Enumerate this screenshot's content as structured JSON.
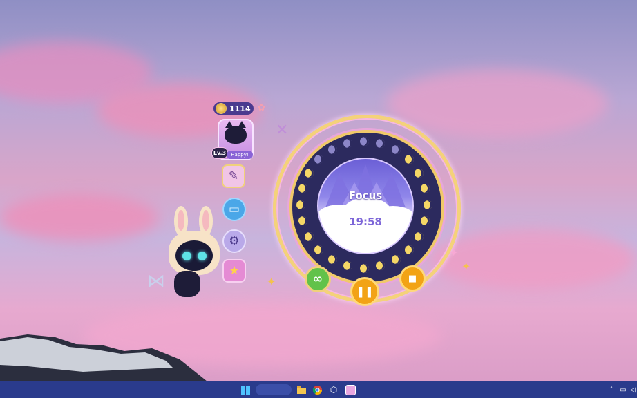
{
  "hud": {
    "coins": "1114",
    "level": "Lv.3",
    "mood": "Happy!"
  },
  "timer": {
    "mode": "Focus",
    "time": "19:58"
  },
  "icons": {
    "coin": "coin-icon",
    "flower": "flower-icon",
    "close": "close-icon",
    "journal": "journal-icon",
    "screen": "screen-icon",
    "settings": "settings-icon",
    "favorites": "star-icon",
    "infinity": "infinity-icon",
    "pause": "pause-icon",
    "stop": "stop-icon"
  },
  "taskbar": {
    "start": "windows-icon",
    "apps": [
      "file-explorer-icon",
      "chrome-icon",
      "app-icon",
      "pet-app-icon"
    ],
    "tray": [
      "chevron-up-icon",
      "network-icon",
      "volume-icon"
    ]
  },
  "colors": {
    "taskbar": "#2a3b8c",
    "gold": "#f0c96a",
    "dial": "#2c2a5e",
    "focus_text": "#ffffff",
    "time_text": "#7d66d8",
    "infinity_button": "#62c24a",
    "pause_button": "#f2a316",
    "stop_button": "#f2a316"
  }
}
